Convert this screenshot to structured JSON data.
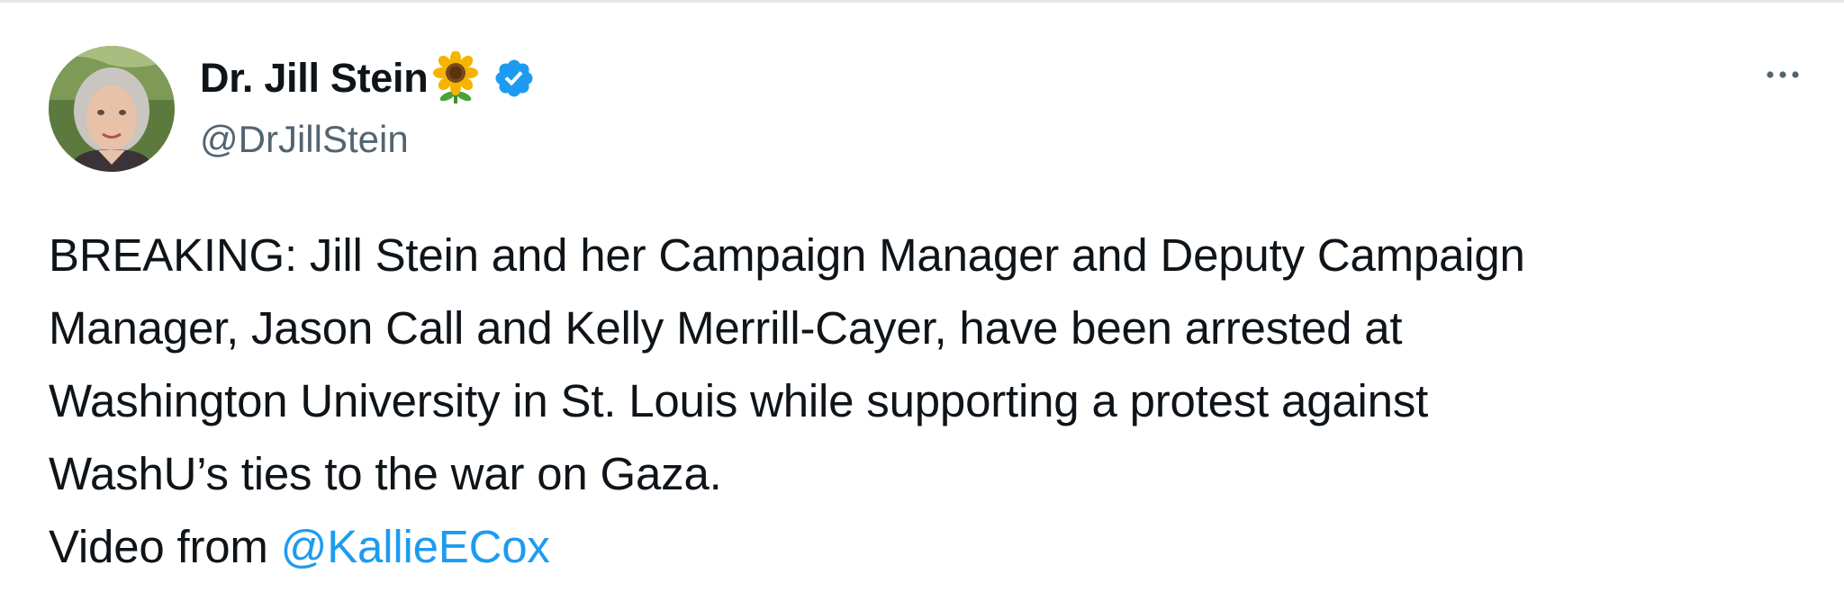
{
  "author": {
    "display_name": "Dr. Jill Stein",
    "handle": "@DrJillStein",
    "name_emoji": "sunflower-icon",
    "verified": true,
    "avatar": "avatar-photo"
  },
  "menu": {
    "icon": "more-horizontal-icon"
  },
  "tweet": {
    "lines": [
      "BREAKING: Jill Stein and her Campaign Manager and Deputy Campaign",
      "Manager, Jason Call and Kelly Merrill-Cayer, have been arrested at",
      "Washington University in St. Louis while supporting a protest against",
      "WashU’s ties to the war on Gaza."
    ],
    "video_prefix": "Video from ",
    "mention": "@KallieECox"
  },
  "colors": {
    "text": "#0f1419",
    "secondary": "#536471",
    "link": "#1d9bf0",
    "verified": "#1d9bf0"
  }
}
